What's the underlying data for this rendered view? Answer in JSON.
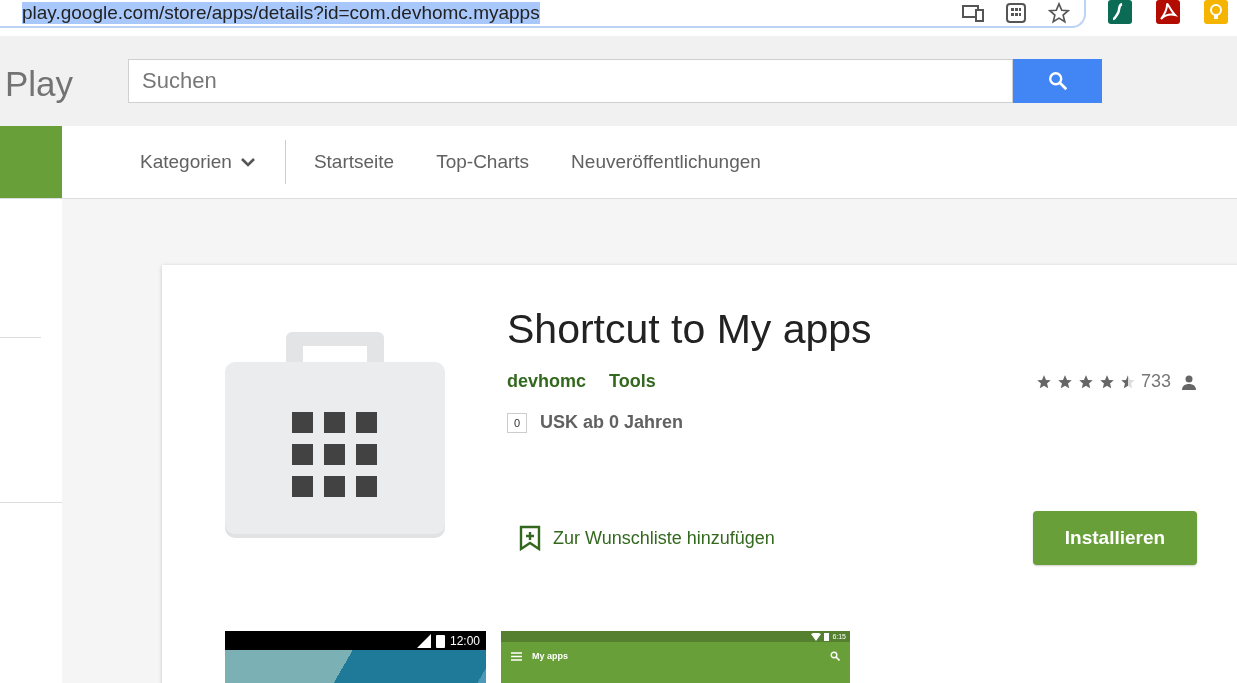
{
  "browser": {
    "url": "play.google.com/store/apps/details?id=com.devhomc.myapps",
    "selected": true
  },
  "header": {
    "logo": "Play",
    "search": {
      "placeholder": "Suchen"
    }
  },
  "nav": {
    "items": [
      {
        "label": "Kategorien",
        "kind": "dropdown"
      },
      {
        "label": "Startseite",
        "kind": "link"
      },
      {
        "label": "Top-Charts",
        "kind": "link"
      },
      {
        "label": "Neuveröffentlichungen",
        "kind": "link"
      }
    ]
  },
  "app": {
    "title": "Shortcut to My apps",
    "developer": "devhomc",
    "category": "Tools",
    "stars": 4.5,
    "rating_count": "733",
    "age_badge": "0",
    "age_rating": "USK ab 0 Jahren",
    "wishlist": "Zur Wunschliste hinzufügen",
    "install": "Installieren"
  },
  "screenshots": [
    {
      "kind": "dark",
      "time": "12:00"
    },
    {
      "kind": "green",
      "time": "6:15",
      "title": "My apps"
    }
  ]
}
